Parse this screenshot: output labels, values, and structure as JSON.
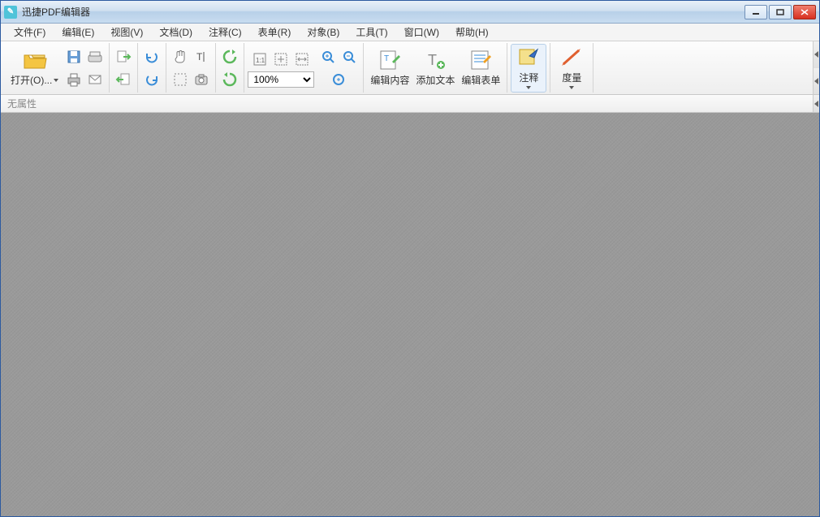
{
  "titlebar": {
    "app_title": "迅捷PDF编辑器"
  },
  "menu": {
    "file": "文件(F)",
    "edit": "编辑(E)",
    "view": "视图(V)",
    "doc": "文档(D)",
    "annot": "注释(C)",
    "form": "表单(R)",
    "object": "对象(B)",
    "tools": "工具(T)",
    "window": "窗口(W)",
    "help": "帮助(H)"
  },
  "toolbar": {
    "open_label": "打开(O)...",
    "zoom_value": "100%",
    "edit_content": "编辑内容",
    "add_text": "添加文本",
    "edit_form": "编辑表单",
    "annotation": "注释",
    "measure": "度量"
  },
  "properties": {
    "none_label": "无属性"
  }
}
